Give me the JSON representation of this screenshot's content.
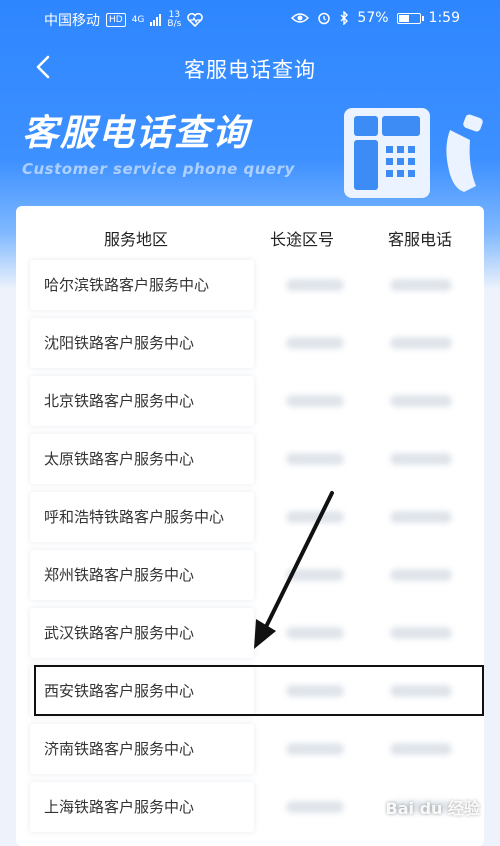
{
  "status_bar": {
    "carrier": "中国移动",
    "hd": "HD",
    "network": "4G",
    "speed_value": "13",
    "speed_unit": "B/s",
    "battery": "57%",
    "battery_level": 0.57,
    "time": "1:59"
  },
  "nav": {
    "title": "客服电话查询"
  },
  "banner": {
    "title": "客服电话查询",
    "subtitle": "Customer service phone query"
  },
  "table": {
    "headers": {
      "region": "服务地区",
      "code": "长途区号",
      "phone": "客服电话"
    },
    "rows": [
      {
        "region": "哈尔滨铁路客户服务中心"
      },
      {
        "region": "沈阳铁路客户服务中心"
      },
      {
        "region": "北京铁路客户服务中心"
      },
      {
        "region": "太原铁路客户服务中心"
      },
      {
        "region": "呼和浩特铁路客户服务中心"
      },
      {
        "region": "郑州铁路客户服务中心"
      },
      {
        "region": "武汉铁路客户服务中心"
      },
      {
        "region": "西安铁路客户服务中心"
      },
      {
        "region": "济南铁路客户服务中心"
      },
      {
        "region": "上海铁路客户服务中心"
      }
    ]
  },
  "watermark": "Bai du 经验",
  "colors": {
    "primary": "#2e86ff",
    "highlight": "#111111"
  }
}
